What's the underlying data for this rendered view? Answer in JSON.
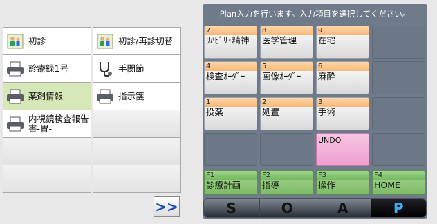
{
  "left_menu": [
    {
      "label": "初診",
      "icon": "family-icon"
    },
    {
      "label": "初診/再診切替",
      "icon": "family-icon"
    },
    {
      "label": "診療録1号",
      "icon": "printer-icon"
    },
    {
      "label": "手関節",
      "icon": "stethoscope-icon"
    },
    {
      "label": "薬剤情報",
      "icon": "printer-icon",
      "selected": true
    },
    {
      "label": "指示箋",
      "icon": "printer-icon"
    },
    {
      "label": "内視鏡検査報告書-胃-",
      "icon": "printer-icon"
    },
    {
      "label": "",
      "icon": ""
    },
    {
      "label": "",
      "icon": ""
    },
    {
      "label": "",
      "icon": ""
    },
    {
      "label": "",
      "icon": ""
    },
    {
      "label": "",
      "icon": ""
    }
  ],
  "next_button": {
    "label": ">>"
  },
  "plan_panel": {
    "title": "Plan入力を行います。入力項目を選択してください。",
    "buttons": [
      {
        "num": "7",
        "label": "ﾘﾊﾋﾞﾘ･精神"
      },
      {
        "num": "8",
        "label": "医学管理"
      },
      {
        "num": "9",
        "label": "在宅"
      },
      {
        "num": "4",
        "label": "検査ｵｰﾀﾞｰ"
      },
      {
        "num": "5",
        "label": "画像ｵｰﾀﾞｰ"
      },
      {
        "num": "6",
        "label": "麻酔"
      },
      {
        "num": "1",
        "label": "投薬"
      },
      {
        "num": "2",
        "label": "処置"
      },
      {
        "num": "3",
        "label": "手術"
      },
      {
        "label": "UNDO"
      },
      {
        "num": "F1",
        "label": "診療計画"
      },
      {
        "num": "F2",
        "label": "指導"
      },
      {
        "num": "F3",
        "label": "操作"
      },
      {
        "num": "F4",
        "label": "HOME"
      }
    ]
  },
  "soap_tabs": [
    {
      "label": "S"
    },
    {
      "label": "O"
    },
    {
      "label": "A"
    },
    {
      "label": "P",
      "active": true
    }
  ],
  "colors": {
    "accent": "#3ab0ee",
    "selected": "#d6e7b8",
    "undo": "#ee9fcf"
  }
}
